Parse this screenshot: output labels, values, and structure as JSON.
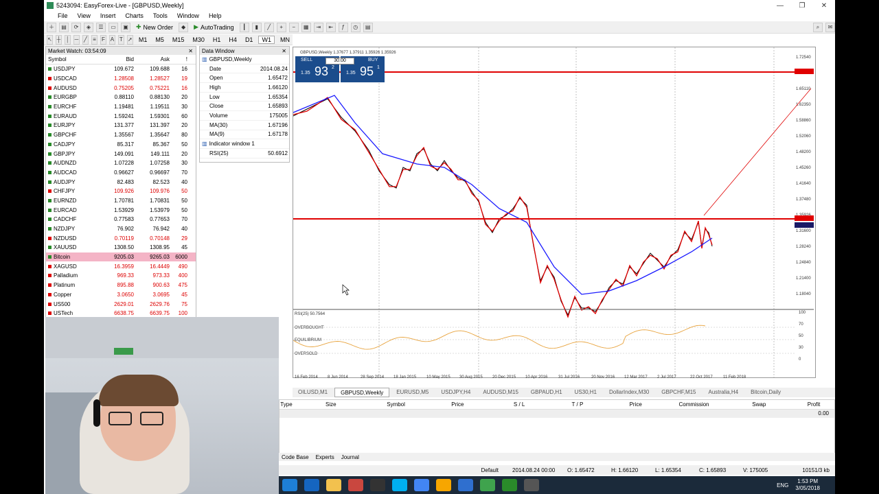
{
  "window": {
    "title": "5243094: EasyForex-Live - [GBPUSD,Weekly]",
    "minimize": "—",
    "restore": "❐",
    "close": "✕"
  },
  "menu": [
    "File",
    "View",
    "Insert",
    "Charts",
    "Tools",
    "Window",
    "Help"
  ],
  "toolbar": {
    "new_order": "New Order",
    "autotrading": "AutoTrading",
    "timeframes": [
      "M1",
      "M5",
      "M15",
      "M30",
      "H1",
      "H4",
      "D1",
      "W1",
      "MN"
    ]
  },
  "market_watch": {
    "title": "Market Watch: 03:54:09",
    "headers": {
      "symbol": "Symbol",
      "bid": "Bid",
      "ask": "Ask",
      "spread": "!"
    },
    "rows": [
      {
        "symbol": "USDJPY",
        "bid": "109.672",
        "ask": "109.688",
        "spread": "16",
        "dir": "up"
      },
      {
        "symbol": "USDCAD",
        "bid": "1.28508",
        "ask": "1.28527",
        "spread": "19",
        "dir": "down"
      },
      {
        "symbol": "AUDUSD",
        "bid": "0.75205",
        "ask": "0.75221",
        "spread": "16",
        "dir": "down"
      },
      {
        "symbol": "EURGBP",
        "bid": "0.88110",
        "ask": "0.88130",
        "spread": "20",
        "dir": "up"
      },
      {
        "symbol": "EURCHF",
        "bid": "1.19481",
        "ask": "1.19511",
        "spread": "30",
        "dir": "up"
      },
      {
        "symbol": "EURAUD",
        "bid": "1.59241",
        "ask": "1.59301",
        "spread": "60",
        "dir": "up"
      },
      {
        "symbol": "EURJPY",
        "bid": "131.377",
        "ask": "131.397",
        "spread": "20",
        "dir": "up"
      },
      {
        "symbol": "GBPCHF",
        "bid": "1.35567",
        "ask": "1.35647",
        "spread": "80",
        "dir": "up"
      },
      {
        "symbol": "CADJPY",
        "bid": "85.317",
        "ask": "85.367",
        "spread": "50",
        "dir": "up"
      },
      {
        "symbol": "GBPJPY",
        "bid": "149.091",
        "ask": "149.111",
        "spread": "20",
        "dir": "up"
      },
      {
        "symbol": "AUDNZD",
        "bid": "1.07228",
        "ask": "1.07258",
        "spread": "30",
        "dir": "up"
      },
      {
        "symbol": "AUDCAD",
        "bid": "0.96627",
        "ask": "0.96697",
        "spread": "70",
        "dir": "up"
      },
      {
        "symbol": "AUDJPY",
        "bid": "82.483",
        "ask": "82.523",
        "spread": "40",
        "dir": "up"
      },
      {
        "symbol": "CHFJPY",
        "bid": "109.926",
        "ask": "109.976",
        "spread": "50",
        "dir": "down"
      },
      {
        "symbol": "EURNZD",
        "bid": "1.70781",
        "ask": "1.70831",
        "spread": "50",
        "dir": "up"
      },
      {
        "symbol": "EURCAD",
        "bid": "1.53929",
        "ask": "1.53979",
        "spread": "50",
        "dir": "up"
      },
      {
        "symbol": "CADCHF",
        "bid": "0.77583",
        "ask": "0.77653",
        "spread": "70",
        "dir": "up"
      },
      {
        "symbol": "NZDJPY",
        "bid": "76.902",
        "ask": "76.942",
        "spread": "40",
        "dir": "up"
      },
      {
        "symbol": "NZDUSD",
        "bid": "0.70119",
        "ask": "0.70148",
        "spread": "29",
        "dir": "down"
      },
      {
        "symbol": "XAUUSD",
        "bid": "1308.50",
        "ask": "1308.95",
        "spread": "45",
        "dir": "up"
      },
      {
        "symbol": "Bitcoin",
        "bid": "9205.03",
        "ask": "9265.03",
        "spread": "6000",
        "dir": "highlight"
      },
      {
        "symbol": "XAGUSD",
        "bid": "16.3959",
        "ask": "16.4449",
        "spread": "490",
        "dir": "down"
      },
      {
        "symbol": "Palladium",
        "bid": "969.33",
        "ask": "973.33",
        "spread": "400",
        "dir": "down"
      },
      {
        "symbol": "Platinum",
        "bid": "895.88",
        "ask": "900.63",
        "spread": "475",
        "dir": "down"
      },
      {
        "symbol": "Copper",
        "bid": "3.0650",
        "ask": "3.0695",
        "spread": "45",
        "dir": "down"
      },
      {
        "symbol": "US500",
        "bid": "2629.01",
        "ask": "2629.76",
        "spread": "75",
        "dir": "down"
      },
      {
        "symbol": "USTech",
        "bid": "6638.75",
        "ask": "6639.75",
        "spread": "100",
        "dir": "down"
      }
    ]
  },
  "data_window": {
    "title": "Data Window",
    "symbol": "GBPUSD,Weekly",
    "rows": [
      {
        "k": "Date",
        "v": "2014.08.24"
      },
      {
        "k": "Open",
        "v": "1.65472"
      },
      {
        "k": "High",
        "v": "1.66120"
      },
      {
        "k": "Low",
        "v": "1.65354"
      },
      {
        "k": "Close",
        "v": "1.65893"
      },
      {
        "k": "Volume",
        "v": "175005"
      },
      {
        "k": "MA(30)",
        "v": "1.67196"
      },
      {
        "k": "MA(9)",
        "v": "1.67178"
      }
    ],
    "indicator_window": "Indicator window 1",
    "rsi": {
      "k": "RSI(25)",
      "v": "50.6912"
    }
  },
  "chart": {
    "header": "GBPUSD,Weekly  1.37677 1.37911 1.35926 1.35926",
    "one_click": {
      "sell": "SELL",
      "buy": "BUY",
      "lot": "30.00",
      "sell_small": "1.35",
      "sell_big": "93",
      "sell_sup": "2",
      "buy_small": "1.35",
      "buy_big": "95",
      "buy_sup": "1"
    },
    "price_labels": [
      "1.72540",
      "1.69860",
      "1.65110",
      "1.62350",
      "1.58860",
      "1.52060",
      "1.48200",
      "1.45260",
      "1.41640",
      "1.37480",
      "1.35926",
      "1.31600",
      "1.28240",
      "1.24840",
      "1.21400",
      "1.18040"
    ],
    "date_labels": [
      "16 Feb 2014",
      "8 Jun 2014",
      "28 Sep 2014",
      "18 Jan 2015",
      "10 May 2015",
      "30 Aug 2015",
      "20 Dec 2015",
      "10 Apr 2016",
      "31 Jul 2016",
      "20 Nov 2016",
      "12 Mar 2017",
      "2 Jul 2017",
      "22 Oct 2017",
      "11 Feb 2018"
    ],
    "rsi_label": "RSI(25) 50.7564",
    "rsi_levels": {
      "overbought": "OVERBOUGHT",
      "equilibrium": "EQUILIBRIUM",
      "oversold": "OVERSOLD"
    },
    "rsi_axis": [
      "100",
      "70",
      "50",
      "30",
      "0"
    ],
    "colors": {
      "price": "#000000",
      "ma_fast": "#e00000",
      "ma_slow": "#1a1aff",
      "hline": "#e00000",
      "rsi": "#e8a33d"
    }
  },
  "chart_tabs": [
    "OILUSD,M1",
    "GBPUSD,Weekly",
    "EURUSD,M5",
    "USDJPY,H4",
    "AUDUSD,M15",
    "GBPAUD,H1",
    "US30,H1",
    "DollarIndex,M30",
    "GBPCHF,M15",
    "Australia,H4",
    "Bitcoin,Daily"
  ],
  "terminal": {
    "headers": [
      "Type",
      "Size",
      "Symbol",
      "Price",
      "S / L",
      "T / P",
      "Price",
      "Commission",
      "Swap",
      "Profit"
    ],
    "balance": "0.00",
    "tabs": [
      "Code Base",
      "Experts",
      "Journal"
    ]
  },
  "status": {
    "profile": "Default",
    "date": "2014.08.24 00:00",
    "open": "O: 1.65472",
    "high": "H: 1.66120",
    "low": "L: 1.65354",
    "close": "C: 1.65893",
    "volume": "V: 175005",
    "traffic": "10151/3 kb"
  },
  "taskbar": {
    "lang": "ENG",
    "time": "1:53 PM",
    "date": "3/05/2018"
  }
}
